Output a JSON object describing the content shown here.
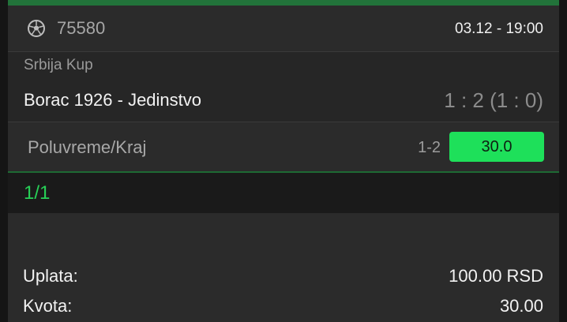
{
  "ticket": {
    "event_id": "75580",
    "event_time": "03.12 - 19:00",
    "sport_icon": "soccer-ball-icon",
    "league": "Srbija Kup",
    "teams": "Borac 1926 - Jedinstvo",
    "score": "1 : 2 (1 : 0)",
    "market": "Poluvreme/Kraj",
    "pick": "1-2",
    "odd": "30.0"
  },
  "count": "1/1",
  "summary": {
    "stake_label": "Uplata:",
    "stake_value": "100.00 RSD",
    "odds_label": "Kvota:",
    "odds_value": "30.00"
  },
  "colors": {
    "accent_green": "#1ee05a",
    "count_green": "#27d057"
  }
}
